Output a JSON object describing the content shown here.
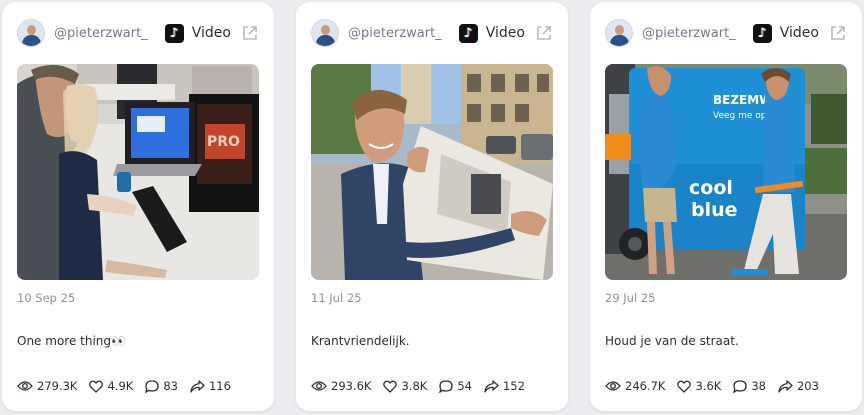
{
  "posts": [
    {
      "handle": "@pieterzwart_",
      "type": "Video",
      "platform_icon": "tiktok-icon",
      "date": "10 Sep 25",
      "caption": "One more thing👀",
      "stats": {
        "views": "279.3K",
        "likes": "4.9K",
        "comments": "83",
        "shares": "116"
      }
    },
    {
      "handle": "@pieterzwart_",
      "type": "Video",
      "platform_icon": "tiktok-icon",
      "date": "11 Jul 25",
      "caption": "Krantvriendelijk.",
      "stats": {
        "views": "293.6K",
        "likes": "3.8K",
        "comments": "54",
        "shares": "152"
      }
    },
    {
      "handle": "@pieterzwart_",
      "type": "Video",
      "platform_icon": "tiktok-icon",
      "date": "29 Jul 25",
      "caption": "Houd je van de straat.",
      "stats": {
        "views": "246.7K",
        "likes": "3.6K",
        "comments": "38",
        "shares": "203"
      },
      "thumbnail_text": {
        "sign_line1": "BEZEMW",
        "sign_line2": "Veeg me op",
        "brand_line1": "cool",
        "brand_line2": "blue"
      }
    }
  ],
  "colors": {
    "page_bg": "#ecedf1",
    "card_bg": "#ffffff",
    "muted_text": "#8a92a0",
    "coolblue_blue": "#1f8fd6",
    "coolblue_orange": "#f28c1c"
  }
}
